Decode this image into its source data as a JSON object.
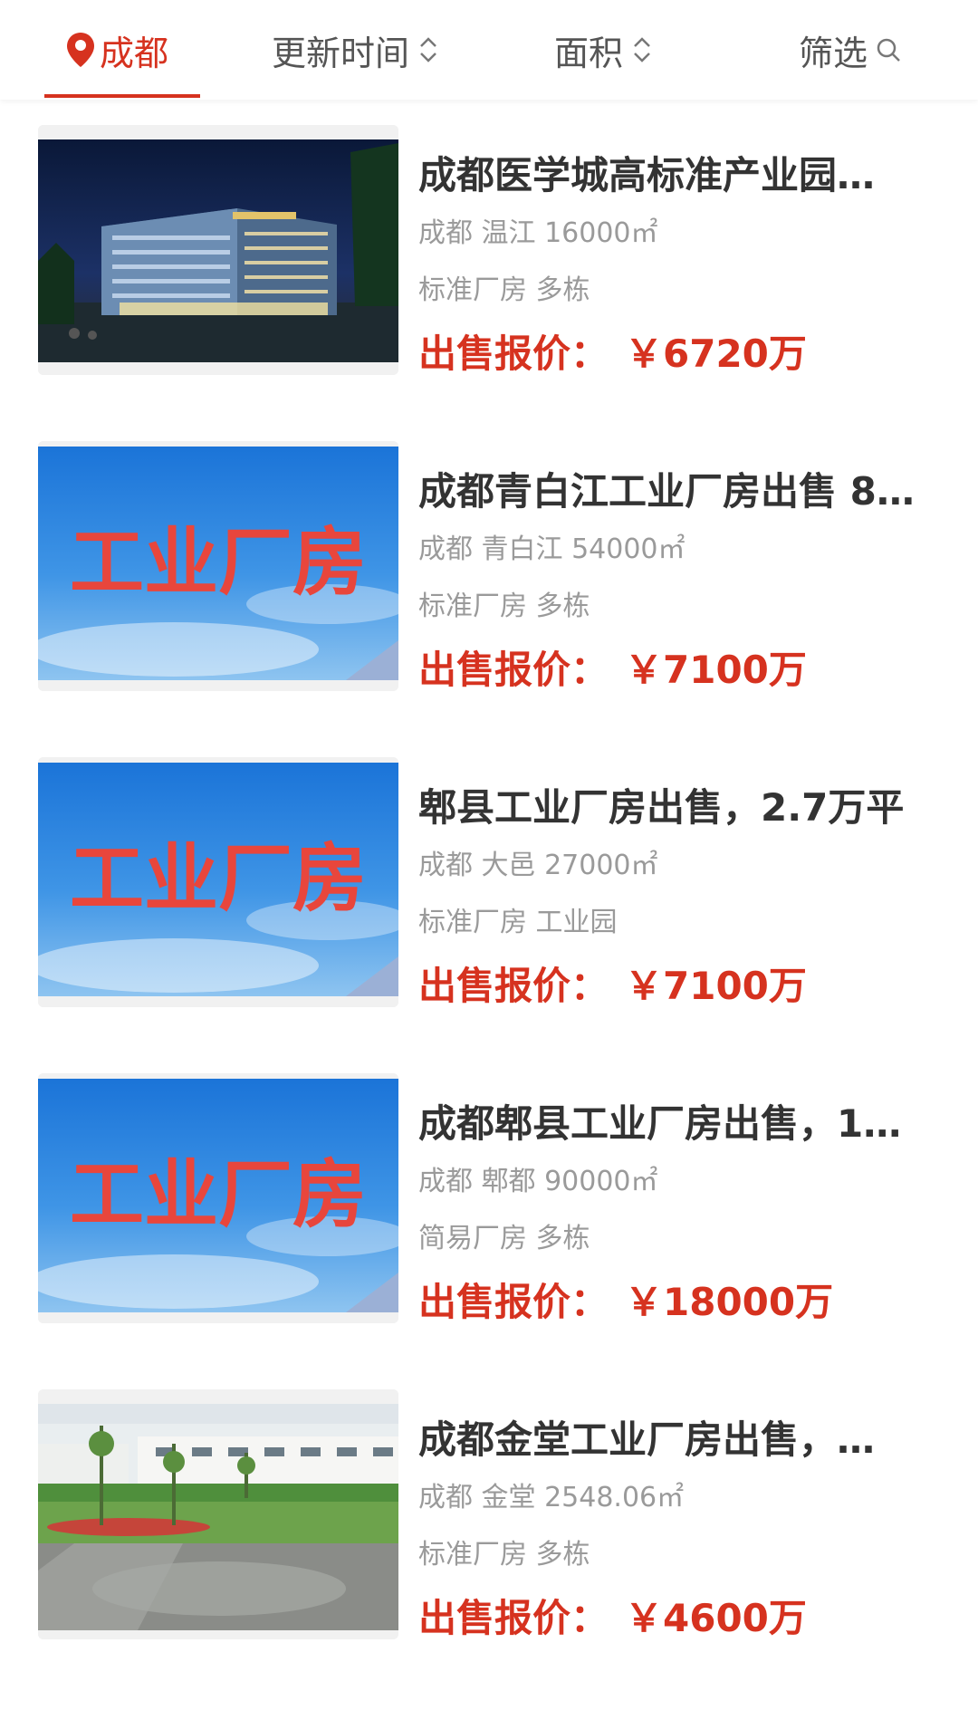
{
  "topbar": {
    "city_label": "成都",
    "update_label": "更新时间",
    "area_label": "面积",
    "filter_label": "筛选"
  },
  "colors": {
    "accent": "#d6321f",
    "title": "#333333",
    "meta": "#9a9a9a"
  },
  "listings": [
    {
      "title": "成都医学城高标准产业园…",
      "location": "成都 温江 16000㎡",
      "tags": "标准厂房 多栋",
      "price_label": "出售报价：",
      "price_value": "￥6720万",
      "image": "night-office-building-photo"
    },
    {
      "title": "成都青白江工业厂房出售 8…",
      "location": "成都 青白江 54000㎡",
      "tags": "标准厂房 多栋",
      "price_label": "出售报价：",
      "price_value": "￥7100万",
      "image_text": "工业厂房"
    },
    {
      "title": "郫县工业厂房出售，2.7万平",
      "location": "成都 大邑 27000㎡",
      "tags": "标准厂房 工业园",
      "price_label": "出售报价：",
      "price_value": "￥7100万",
      "image_text": "工业厂房"
    },
    {
      "title": "成都郫县工业厂房出售，1…",
      "location": "成都 郫都 90000㎡",
      "tags": "简易厂房 多栋",
      "price_label": "出售报价：",
      "price_value": "￥18000万",
      "image_text": "工业厂房"
    },
    {
      "title": "成都金堂工业厂房出售，…",
      "location": "成都 金堂 2548.06㎡",
      "tags": "标准厂房 多栋",
      "price_label": "出售报价：",
      "price_value": "￥4600万",
      "image": "factory-yard-photo"
    }
  ]
}
